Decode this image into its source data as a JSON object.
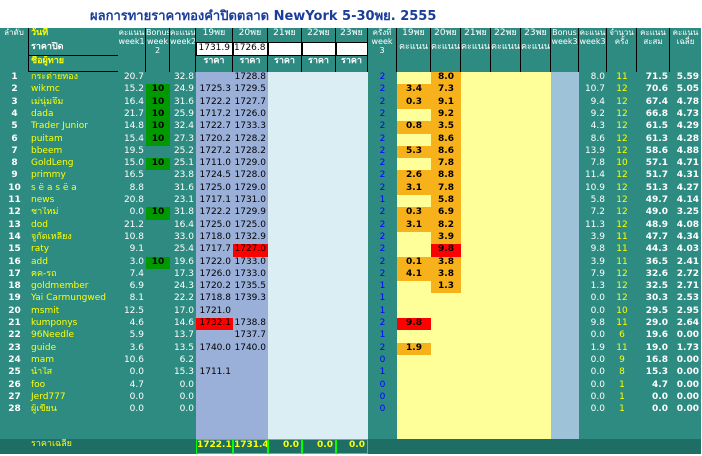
{
  "title": "ผลการทายราคาทองคำปิดตลาด NewYork  5-30พย. 2555",
  "header": {
    "row_label": "ลำดับ",
    "date_label": "วันที่",
    "close_label": "ราคาปิด",
    "name_label": "ชื่อผู้ทาย",
    "score_w1": "คะแนน week1",
    "bonus_w2": "Bonus week 2",
    "score_w2": "คะแนน week2",
    "dates": [
      "19พย",
      "20พย",
      "21พย",
      "22พย",
      "23พย"
    ],
    "close_prices": [
      "1731.9",
      "1726.8",
      "",
      "",
      ""
    ],
    "price_label": "ราคา",
    "times_w3": "ครั้งที่ week 3",
    "score_label": "คะแนน",
    "bonus_w3": "Bonus week3",
    "score_w3": "คะแนน week3",
    "count_label": "จำนวน ครั้ง",
    "total_label": "คะแนน สะสม",
    "avg_label": "คะแนน เฉลี่ย",
    "avg_row_label": "ราคาเฉลี่ย"
  },
  "rows": [
    {
      "n": "1",
      "name": "กระต่ายทอง",
      "w1": "20.7",
      "b2": "",
      "w2": "32.8",
      "p1": "",
      "p2": "1728.8",
      "t": "2",
      "s1": "",
      "s2": "8.0",
      "b3": "",
      "w3": "8.0",
      "cnt": "11",
      "tot": "71.5",
      "avg": "5.59"
    },
    {
      "n": "2",
      "name": "wikmc",
      "w1": "15.2",
      "b2": "10",
      "w2": "24.9",
      "p1": "1725.3",
      "p2": "1729.5",
      "t": "2",
      "s1": "3.4",
      "s2": "7.3",
      "b3": "",
      "w3": "10.7",
      "cnt": "12",
      "tot": "70.6",
      "avg": "5.05"
    },
    {
      "n": "3",
      "name": "เม่นุ่มจึ้ม",
      "w1": "16.4",
      "b2": "10",
      "w2": "31.6",
      "p1": "1722.2",
      "p2": "1727.7",
      "t": "2",
      "s1": "0.3",
      "s2": "9.1",
      "b3": "",
      "w3": "9.4",
      "cnt": "12",
      "tot": "67.4",
      "avg": "4.78"
    },
    {
      "n": "4",
      "name": "dada",
      "w1": "21.7",
      "b2": "10",
      "w2": "25.9",
      "p1": "1717.2",
      "p2": "1726.0",
      "t": "2",
      "s1": "",
      "s2": "9.2",
      "b3": "",
      "w3": "9.2",
      "cnt": "12",
      "tot": "66.8",
      "avg": "4.73"
    },
    {
      "n": "5",
      "name": "Trader Junior",
      "w1": "14.8",
      "b2": "10",
      "w2": "32.4",
      "p1": "1722.7",
      "p2": "1733.3",
      "t": "2",
      "s1": "0.8",
      "s2": "3.5",
      "b3": "",
      "w3": "4.3",
      "cnt": "12",
      "tot": "61.5",
      "avg": "4.29"
    },
    {
      "n": "6",
      "name": "puitam",
      "w1": "15.4",
      "b2": "10",
      "w2": "27.3",
      "p1": "1720.2",
      "p2": "1728.2",
      "t": "2",
      "s1": "",
      "s2": "8.6",
      "b3": "",
      "w3": "8.6",
      "cnt": "12",
      "tot": "61.3",
      "avg": "4.28"
    },
    {
      "n": "7",
      "name": "bbeem",
      "w1": "19.5",
      "b2": "",
      "w2": "25.2",
      "p1": "1727.2",
      "p2": "1728.2",
      "t": "2",
      "s1": "5.3",
      "s2": "8.6",
      "b3": "",
      "w3": "13.9",
      "cnt": "12",
      "tot": "58.6",
      "avg": "4.88"
    },
    {
      "n": "8",
      "name": "GoldLeng",
      "w1": "15.0",
      "b2": "10",
      "w2": "25.1",
      "p1": "1711.0",
      "p2": "1729.0",
      "t": "2",
      "s1": "",
      "s2": "7.8",
      "b3": "",
      "w3": "7.8",
      "cnt": "10",
      "tot": "57.1",
      "avg": "4.71"
    },
    {
      "n": "9",
      "name": "primmy",
      "w1": "16.5",
      "b2": "",
      "w2": "23.8",
      "p1": "1724.5",
      "p2": "1728.0",
      "t": "2",
      "s1": "2.6",
      "s2": "8.8",
      "b3": "",
      "w3": "11.4",
      "cnt": "12",
      "tot": "51.7",
      "avg": "4.31"
    },
    {
      "n": "10",
      "name": "s ë a s ë a",
      "w1": "8.8",
      "b2": "",
      "w2": "31.6",
      "p1": "1725.0",
      "p2": "1729.0",
      "t": "2",
      "s1": "3.1",
      "s2": "7.8",
      "b3": "",
      "w3": "10.9",
      "cnt": "12",
      "tot": "51.3",
      "avg": "4.27"
    },
    {
      "n": "11",
      "name": "news",
      "w1": "20.8",
      "b2": "",
      "w2": "23.1",
      "p1": "1717.1",
      "p2": "1731.0",
      "t": "1",
      "s1": "",
      "s2": "5.8",
      "b3": "",
      "w3": "5.8",
      "cnt": "12",
      "tot": "49.7",
      "avg": "4.14"
    },
    {
      "n": "12",
      "name": "ชาใหม่",
      "w1": "0.0",
      "b2": "10",
      "w2": "31.8",
      "p1": "1722.2",
      "p2": "1729.9",
      "t": "2",
      "s1": "0.3",
      "s2": "6.9",
      "b3": "",
      "w3": "7.2",
      "cnt": "12",
      "tot": "49.0",
      "avg": "3.25"
    },
    {
      "n": "13",
      "name": "dod",
      "w1": "21.2",
      "b2": "",
      "w2": "16.4",
      "p1": "1725.0",
      "p2": "1725.0",
      "t": "2",
      "s1": "3.1",
      "s2": "8.2",
      "b3": "",
      "w3": "11.3",
      "cnt": "12",
      "tot": "48.9",
      "avg": "4.08"
    },
    {
      "n": "14",
      "name": "จูกัดเหลียง",
      "w1": "10.8",
      "b2": "",
      "w2": "33.0",
      "p1": "1718.0",
      "p2": "1732.9",
      "t": "2",
      "s1": "",
      "s2": "3.9",
      "b3": "",
      "w3": "3.9",
      "cnt": "11",
      "tot": "47.7",
      "avg": "4.34"
    },
    {
      "n": "15",
      "name": "raty",
      "w1": "9.1",
      "b2": "",
      "w2": "25.4",
      "p1": "1717.7",
      "p2": "1727.0",
      "t": "2",
      "s1": "",
      "s2": "9.8",
      "b3": "",
      "w3": "9.8",
      "cnt": "11",
      "tot": "44.3",
      "avg": "4.03"
    },
    {
      "n": "16",
      "name": "add",
      "w1": "3.0",
      "b2": "10",
      "w2": "19.6",
      "p1": "1722.0",
      "p2": "1733.0",
      "t": "2",
      "s1": "0.1",
      "s2": "3.8",
      "b3": "",
      "w3": "3.9",
      "cnt": "11",
      "tot": "36.5",
      "avg": "2.41"
    },
    {
      "n": "17",
      "name": "ฅค-รถ",
      "w1": "7.4",
      "b2": "",
      "w2": "17.3",
      "p1": "1726.0",
      "p2": "1733.0",
      "t": "2",
      "s1": "4.1",
      "s2": "3.8",
      "b3": "",
      "w3": "7.9",
      "cnt": "12",
      "tot": "32.6",
      "avg": "2.72"
    },
    {
      "n": "18",
      "name": "goldmember",
      "w1": "6.9",
      "b2": "",
      "w2": "24.3",
      "p1": "1720.2",
      "p2": "1735.5",
      "t": "1",
      "s1": "",
      "s2": "1.3",
      "b3": "",
      "w3": "1.3",
      "cnt": "12",
      "tot": "32.5",
      "avg": "2.71"
    },
    {
      "n": "19",
      "name": "Yai Carmungwed",
      "w1": "8.1",
      "b2": "",
      "w2": "22.2",
      "p1": "1718.8",
      "p2": "1739.3",
      "t": "1",
      "s1": "",
      "s2": "",
      "b3": "",
      "w3": "0.0",
      "cnt": "12",
      "tot": "30.3",
      "avg": "2.53"
    },
    {
      "n": "20",
      "name": "msmit",
      "w1": "12.5",
      "b2": "",
      "w2": "17.0",
      "p1": "1721.0",
      "p2": "",
      "t": "1",
      "s1": "",
      "s2": "",
      "b3": "",
      "w3": "0.0",
      "cnt": "10",
      "tot": "29.5",
      "avg": "2.95"
    },
    {
      "n": "21",
      "name": "kumponys",
      "w1": "4.6",
      "b2": "",
      "w2": "14.6",
      "p1": "1732.1",
      "p2": "1738.8",
      "t": "2",
      "s1": "9.8",
      "s2": "",
      "b3": "",
      "w3": "9.8",
      "cnt": "11",
      "tot": "29.0",
      "avg": "2.64"
    },
    {
      "n": "22",
      "name": "96Needle",
      "w1": "5.9",
      "b2": "",
      "w2": "13.7",
      "p1": "",
      "p2": "1737.7",
      "t": "1",
      "s1": "",
      "s2": "",
      "b3": "",
      "w3": "0.0",
      "cnt": "6",
      "tot": "19.6",
      "avg": "0.00"
    },
    {
      "n": "23",
      "name": "guide",
      "w1": "3.6",
      "b2": "",
      "w2": "13.5",
      "p1": "1740.0",
      "p2": "1740.0",
      "t": "2",
      "s1": "1.9",
      "s2": "",
      "b3": "",
      "w3": "1.9",
      "cnt": "11",
      "tot": "19.0",
      "avg": "1.73"
    },
    {
      "n": "24",
      "name": "mam",
      "w1": "10.6",
      "b2": "",
      "w2": "6.2",
      "p1": "",
      "p2": "",
      "t": "0",
      "s1": "",
      "s2": "",
      "b3": "",
      "w3": "0.0",
      "cnt": "9",
      "tot": "16.8",
      "avg": "0.00"
    },
    {
      "n": "25",
      "name": "น้ำใส",
      "w1": "0.0",
      "b2": "",
      "w2": "15.3",
      "p1": "1711.1",
      "p2": "",
      "t": "1",
      "s1": "",
      "s2": "",
      "b3": "",
      "w3": "0.0",
      "cnt": "8",
      "tot": "15.3",
      "avg": "0.00"
    },
    {
      "n": "26",
      "name": "foo",
      "w1": "4.7",
      "b2": "",
      "w2": "0.0",
      "p1": "",
      "p2": "",
      "t": "0",
      "s1": "",
      "s2": "",
      "b3": "",
      "w3": "0.0",
      "cnt": "1",
      "tot": "4.7",
      "avg": "0.00"
    },
    {
      "n": "27",
      "name": "Jerd777",
      "w1": "0.0",
      "b2": "",
      "w2": "0.0",
      "p1": "",
      "p2": "",
      "t": "0",
      "s1": "",
      "s2": "",
      "b3": "",
      "w3": "0.0",
      "cnt": "1",
      "tot": "0.0",
      "avg": "0.00"
    },
    {
      "n": "28",
      "name": "ผู้เขียน",
      "w1": "0.0",
      "b2": "",
      "w2": "0.0",
      "p1": "",
      "p2": "",
      "t": "0",
      "s1": "",
      "s2": "",
      "b3": "",
      "w3": "0.0",
      "cnt": "1",
      "tot": "0.0",
      "avg": "0.00"
    }
  ],
  "avg_row": {
    "p1": "1722.1",
    "p2": "1731.4",
    "p3": "0.0",
    "p4": "0.0",
    "p5": "0.0"
  },
  "colors": {
    "teal": "#2e8b82",
    "teal_dark": "#1f6e66",
    "header_blue": "#1a3d9b",
    "name_text": "#ffff00",
    "num_text": "#ffffff",
    "light_blue": "#9ec3d8",
    "price_blue": "#9bb0d8",
    "pale_cyan": "#daeef3",
    "pale_yellow": "#ffff99",
    "orange": "#f7b21b",
    "red": "#ff0000",
    "bonus_green": "#009900",
    "lime": "#00ff00"
  },
  "highlights": {
    "p1_red_rows": [
      21
    ],
    "p2_red_rows": [
      15
    ],
    "s1_red_rows": [
      21
    ],
    "s2_red_rows": [
      15
    ]
  }
}
